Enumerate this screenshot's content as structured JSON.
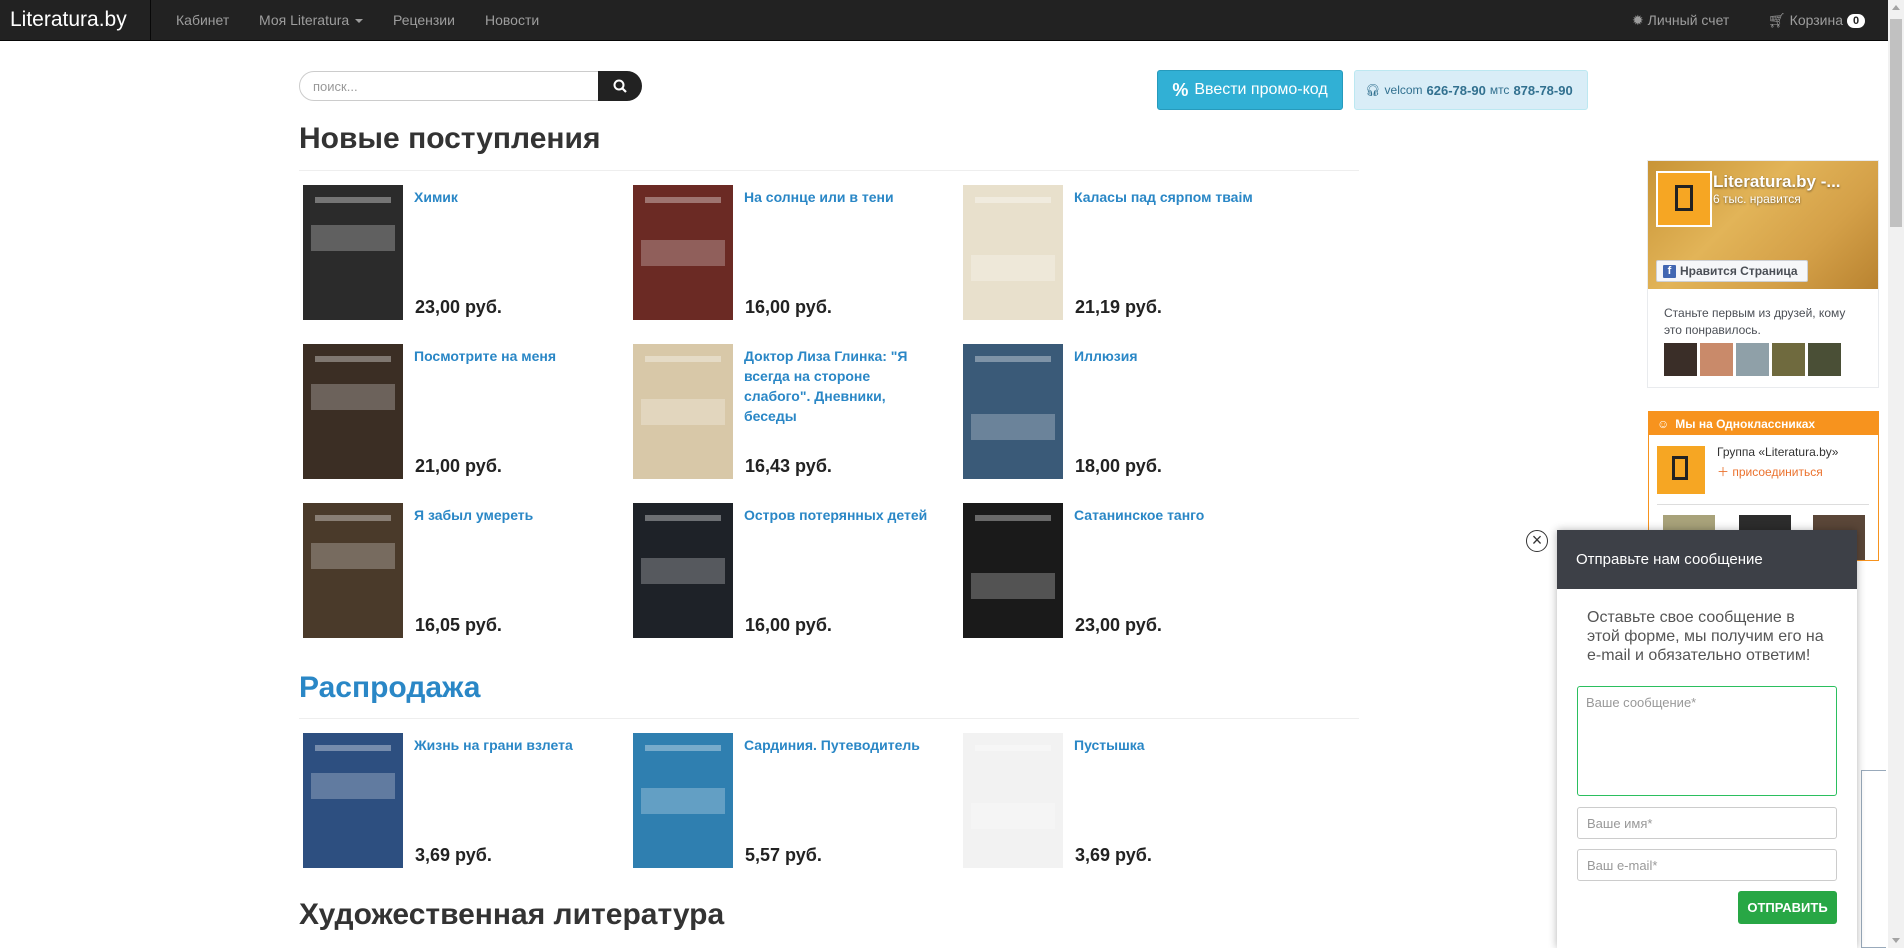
{
  "navbar": {
    "brand": "Literatura.by",
    "links": [
      "Кабинет",
      "Моя Literatura",
      "Рецензии",
      "Новости"
    ],
    "account": "Личный счет",
    "cart": "Корзина",
    "cart_count": "0"
  },
  "search": {
    "placeholder": "поиск..."
  },
  "promo": {
    "percent": "%",
    "label": "Ввести промо-код"
  },
  "phones": {
    "op1": "velcom",
    "num1": "626-78-90",
    "op2": "мтс",
    "num2": "878-78-90"
  },
  "sections": {
    "new": "Новые поступления",
    "sale": "Распродажа",
    "fiction": "Художественная литература"
  },
  "products": [
    {
      "title": "Химик",
      "price": "23,00 руб.",
      "cover": "#2b2b2b"
    },
    {
      "title": "На солнце или в тени",
      "price": "16,00 руб.",
      "cover": "#6b2a24"
    },
    {
      "title": "Каласы пад сярпом тваім",
      "price": "21,19 руб.",
      "cover": "#e8e0cc"
    },
    {
      "title": "Посмотрите на меня",
      "price": "21,00 руб.",
      "cover": "#3b2e24"
    },
    {
      "title": "Доктор Лиза Глинка: \"Я всегда на стороне слабого\". Дневники, беседы",
      "price": "16,43 руб.",
      "cover": "#d8c8a8"
    },
    {
      "title": "Иллюзия",
      "price": "18,00 руб.",
      "cover": "#3a5a78"
    },
    {
      "title": "Я забыл умереть",
      "price": "16,05 руб.",
      "cover": "#4a3a2a"
    },
    {
      "title": "Остров потерянных детей",
      "price": "16,00 руб.",
      "cover": "#1e2228"
    },
    {
      "title": "Сатанинское танго",
      "price": "23,00 руб.",
      "cover": "#1a1a1a"
    }
  ],
  "sale_products": [
    {
      "title": "Жизнь на грани взлета",
      "price": "3,69 руб.",
      "cover": "#2d4f80"
    },
    {
      "title": "Сардиния. Путеводитель",
      "price": "5,57 руб.",
      "cover": "#2f7fb0"
    },
    {
      "title": "Пустышка",
      "price": "3,69 руб.",
      "cover": "#f2f2f2"
    }
  ],
  "facebook": {
    "page_name": "Literatura.by -...",
    "likes": "6 тыс. нравится",
    "like_button": "Нравится Страница",
    "friends_text": "Станьте первым из друзей, кому это понравилось."
  },
  "ok": {
    "header": "Мы на Одноклассниках",
    "group": "Группа «Literatura.by»",
    "join": "присоединиться"
  },
  "chat": {
    "header": "Отправьте нам сообщение",
    "intro": "Оставьте свое сообщение в этой форме, мы получим его на e-mail и обязательно ответим!",
    "message_placeholder": "Ваше сообщение*",
    "name_placeholder": "Ваше имя*",
    "email_placeholder": "Ваш e-mail*",
    "send": "ОТПРАВИТЬ"
  }
}
